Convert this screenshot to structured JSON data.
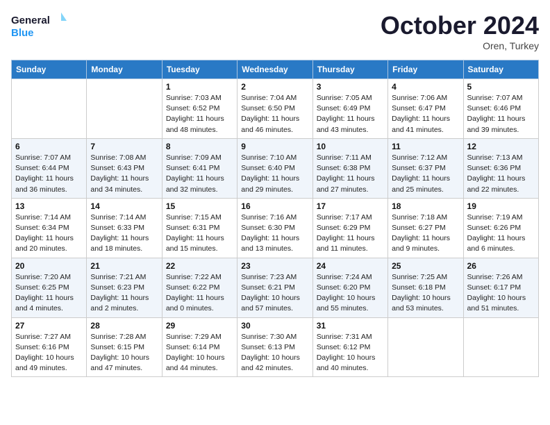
{
  "header": {
    "logo_line1": "General",
    "logo_line2": "Blue",
    "month": "October 2024",
    "location": "Oren, Turkey"
  },
  "weekdays": [
    "Sunday",
    "Monday",
    "Tuesday",
    "Wednesday",
    "Thursday",
    "Friday",
    "Saturday"
  ],
  "weeks": [
    [
      null,
      null,
      {
        "day": "1",
        "sunrise": "7:03 AM",
        "sunset": "6:52 PM",
        "daylight": "11 hours and 48 minutes."
      },
      {
        "day": "2",
        "sunrise": "7:04 AM",
        "sunset": "6:50 PM",
        "daylight": "11 hours and 46 minutes."
      },
      {
        "day": "3",
        "sunrise": "7:05 AM",
        "sunset": "6:49 PM",
        "daylight": "11 hours and 43 minutes."
      },
      {
        "day": "4",
        "sunrise": "7:06 AM",
        "sunset": "6:47 PM",
        "daylight": "11 hours and 41 minutes."
      },
      {
        "day": "5",
        "sunrise": "7:07 AM",
        "sunset": "6:46 PM",
        "daylight": "11 hours and 39 minutes."
      }
    ],
    [
      {
        "day": "6",
        "sunrise": "7:07 AM",
        "sunset": "6:44 PM",
        "daylight": "11 hours and 36 minutes."
      },
      {
        "day": "7",
        "sunrise": "7:08 AM",
        "sunset": "6:43 PM",
        "daylight": "11 hours and 34 minutes."
      },
      {
        "day": "8",
        "sunrise": "7:09 AM",
        "sunset": "6:41 PM",
        "daylight": "11 hours and 32 minutes."
      },
      {
        "day": "9",
        "sunrise": "7:10 AM",
        "sunset": "6:40 PM",
        "daylight": "11 hours and 29 minutes."
      },
      {
        "day": "10",
        "sunrise": "7:11 AM",
        "sunset": "6:38 PM",
        "daylight": "11 hours and 27 minutes."
      },
      {
        "day": "11",
        "sunrise": "7:12 AM",
        "sunset": "6:37 PM",
        "daylight": "11 hours and 25 minutes."
      },
      {
        "day": "12",
        "sunrise": "7:13 AM",
        "sunset": "6:36 PM",
        "daylight": "11 hours and 22 minutes."
      }
    ],
    [
      {
        "day": "13",
        "sunrise": "7:14 AM",
        "sunset": "6:34 PM",
        "daylight": "11 hours and 20 minutes."
      },
      {
        "day": "14",
        "sunrise": "7:14 AM",
        "sunset": "6:33 PM",
        "daylight": "11 hours and 18 minutes."
      },
      {
        "day": "15",
        "sunrise": "7:15 AM",
        "sunset": "6:31 PM",
        "daylight": "11 hours and 15 minutes."
      },
      {
        "day": "16",
        "sunrise": "7:16 AM",
        "sunset": "6:30 PM",
        "daylight": "11 hours and 13 minutes."
      },
      {
        "day": "17",
        "sunrise": "7:17 AM",
        "sunset": "6:29 PM",
        "daylight": "11 hours and 11 minutes."
      },
      {
        "day": "18",
        "sunrise": "7:18 AM",
        "sunset": "6:27 PM",
        "daylight": "11 hours and 9 minutes."
      },
      {
        "day": "19",
        "sunrise": "7:19 AM",
        "sunset": "6:26 PM",
        "daylight": "11 hours and 6 minutes."
      }
    ],
    [
      {
        "day": "20",
        "sunrise": "7:20 AM",
        "sunset": "6:25 PM",
        "daylight": "11 hours and 4 minutes."
      },
      {
        "day": "21",
        "sunrise": "7:21 AM",
        "sunset": "6:23 PM",
        "daylight": "11 hours and 2 minutes."
      },
      {
        "day": "22",
        "sunrise": "7:22 AM",
        "sunset": "6:22 PM",
        "daylight": "11 hours and 0 minutes."
      },
      {
        "day": "23",
        "sunrise": "7:23 AM",
        "sunset": "6:21 PM",
        "daylight": "10 hours and 57 minutes."
      },
      {
        "day": "24",
        "sunrise": "7:24 AM",
        "sunset": "6:20 PM",
        "daylight": "10 hours and 55 minutes."
      },
      {
        "day": "25",
        "sunrise": "7:25 AM",
        "sunset": "6:18 PM",
        "daylight": "10 hours and 53 minutes."
      },
      {
        "day": "26",
        "sunrise": "7:26 AM",
        "sunset": "6:17 PM",
        "daylight": "10 hours and 51 minutes."
      }
    ],
    [
      {
        "day": "27",
        "sunrise": "7:27 AM",
        "sunset": "6:16 PM",
        "daylight": "10 hours and 49 minutes."
      },
      {
        "day": "28",
        "sunrise": "7:28 AM",
        "sunset": "6:15 PM",
        "daylight": "10 hours and 47 minutes."
      },
      {
        "day": "29",
        "sunrise": "7:29 AM",
        "sunset": "6:14 PM",
        "daylight": "10 hours and 44 minutes."
      },
      {
        "day": "30",
        "sunrise": "7:30 AM",
        "sunset": "6:13 PM",
        "daylight": "10 hours and 42 minutes."
      },
      {
        "day": "31",
        "sunrise": "7:31 AM",
        "sunset": "6:12 PM",
        "daylight": "10 hours and 40 minutes."
      },
      null,
      null
    ]
  ]
}
